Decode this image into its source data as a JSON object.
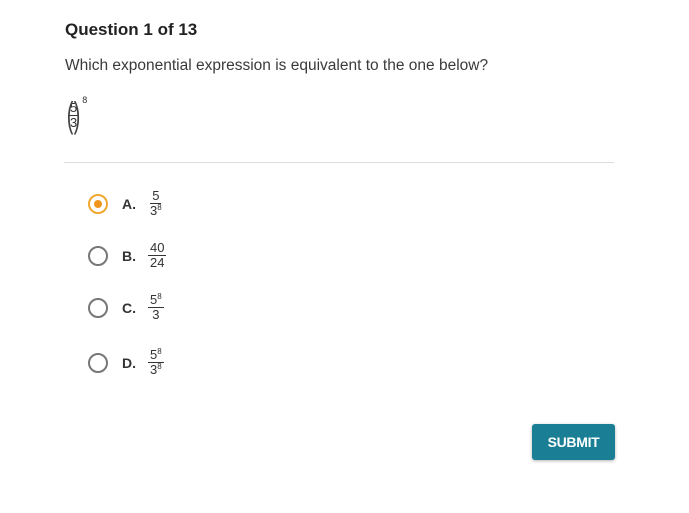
{
  "question": {
    "title": "Question 1 of 13",
    "prompt": "Which exponential expression is equivalent to the one below?",
    "expression": {
      "numerator": "5",
      "denominator": "3",
      "exponent": "8"
    }
  },
  "options": [
    {
      "letter": "A.",
      "numerator": "5",
      "numerator_exp": "",
      "denominator": "3",
      "denominator_exp": "8",
      "selected": true
    },
    {
      "letter": "B.",
      "numerator": "40",
      "numerator_exp": "",
      "denominator": "24",
      "denominator_exp": "",
      "selected": false
    },
    {
      "letter": "C.",
      "numerator": "5",
      "numerator_exp": "8",
      "denominator": "3",
      "denominator_exp": "",
      "selected": false
    },
    {
      "letter": "D.",
      "numerator": "5",
      "numerator_exp": "8",
      "denominator": "3",
      "denominator_exp": "8",
      "selected": false
    }
  ],
  "submit_label": "SUBMIT",
  "colors": {
    "accent": "#f0961e",
    "submit": "#1a7f95"
  }
}
